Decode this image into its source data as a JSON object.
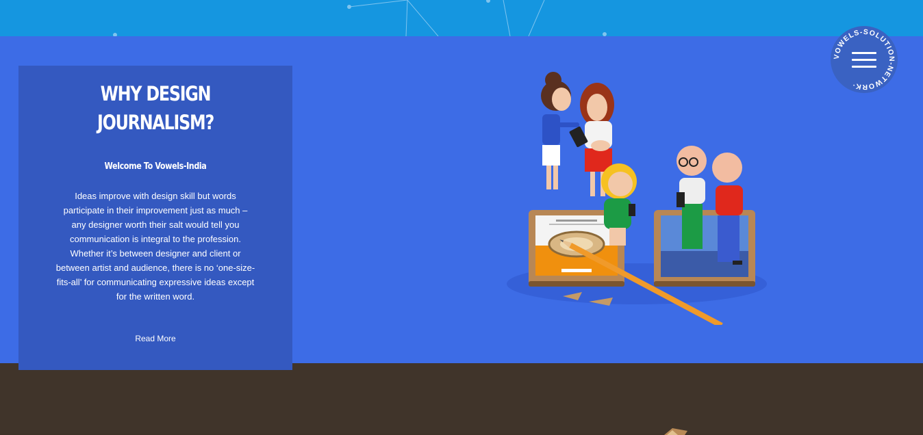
{
  "card": {
    "title_line1": "WHY DESIGN",
    "title_line2": "JOURNALISM?",
    "subtitle": "Welcome To Vowels-India",
    "body": "Ideas improve with design skill but words participate in their improvement just as much – any designer worth their salt would tell you communication is integral to the profession. Whether it’s between designer and client or between artist and audience, there is no ‘one-size-fits-all’ for communicating expressive ideas except for the written word.",
    "read_more": "Read More"
  },
  "badge": {
    "ring_text": "VOWELS-SOLUTION-NETWORK·",
    "menu_icon": "hamburger-menu-icon"
  },
  "colors": {
    "top_band": "#1596e0",
    "hero": "#3d6ce6",
    "card": "#3459c0",
    "footer": "#40342a"
  }
}
